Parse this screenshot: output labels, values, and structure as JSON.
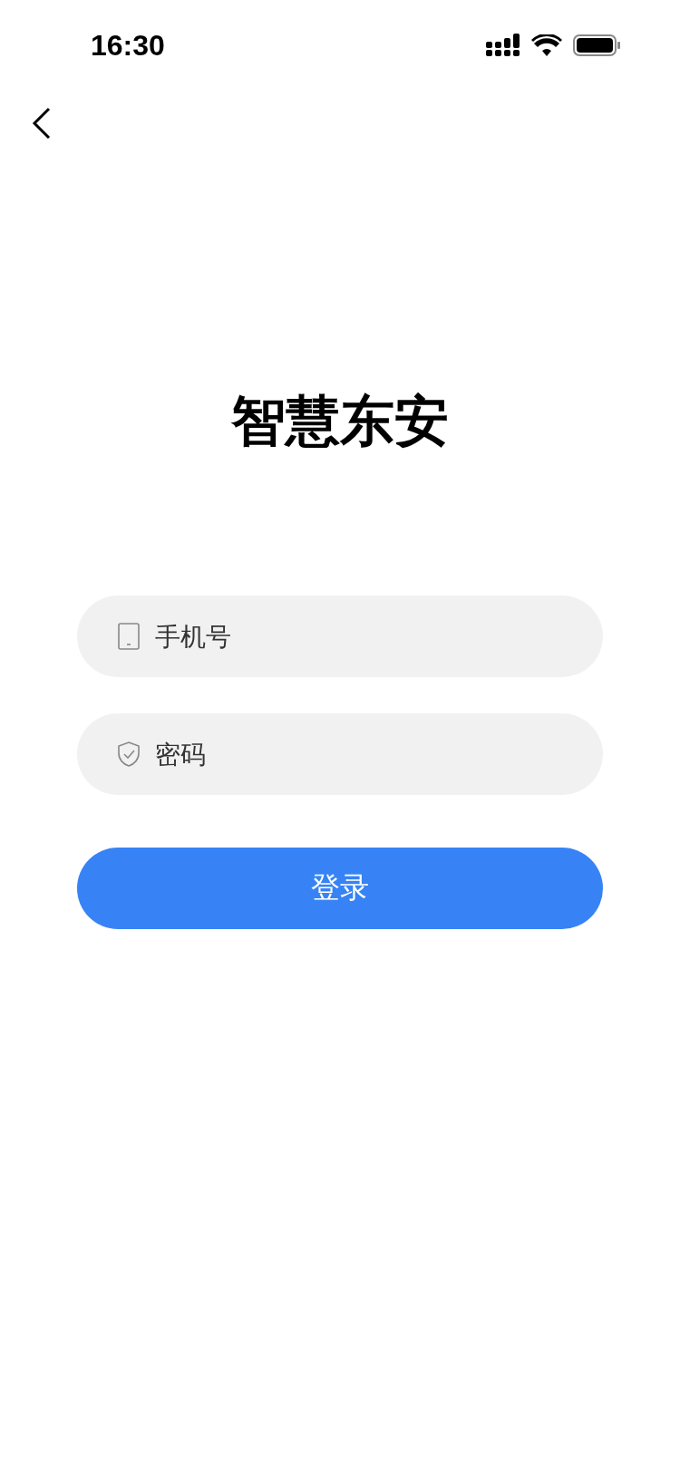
{
  "status_bar": {
    "time": "16:30"
  },
  "title": "智慧东安",
  "fields": [
    {
      "kind": "phone",
      "placeholder": "手机号"
    },
    {
      "kind": "password",
      "placeholder": "密码"
    }
  ],
  "login_button": {
    "label": "登录"
  }
}
